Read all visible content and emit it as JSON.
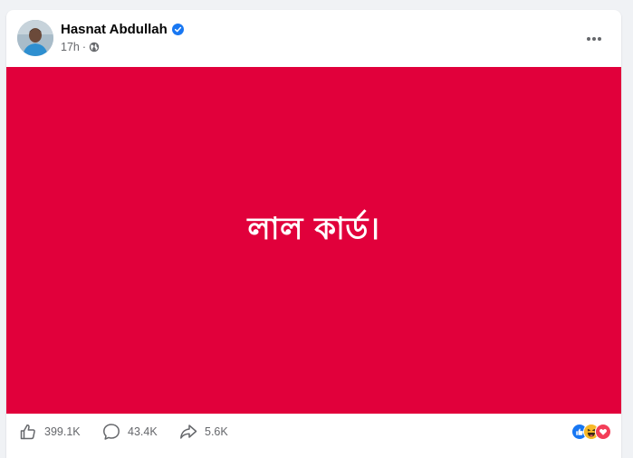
{
  "post": {
    "author_name": "Hasnat Abdullah",
    "verified": true,
    "time": "17h",
    "separator": "·",
    "audience_icon": "globe-icon",
    "more_icon": "more-horizontal-icon"
  },
  "media": {
    "background_color": "#e1003b",
    "text": "লাল কার্ড।",
    "text_color": "#ffffff"
  },
  "footer": {
    "likes": "399.1K",
    "comments": "43.4K",
    "shares": "5.6K",
    "like_icon": "thumbs-up-icon",
    "comment_icon": "comment-bubble-icon",
    "share_icon": "share-arrow-icon",
    "reactions": [
      "like-reaction-icon",
      "haha-reaction-icon",
      "love-reaction-icon"
    ]
  },
  "colors": {
    "accent": "#1877f2",
    "muted_text": "#65676b",
    "page_background": "#f0f2f5"
  }
}
